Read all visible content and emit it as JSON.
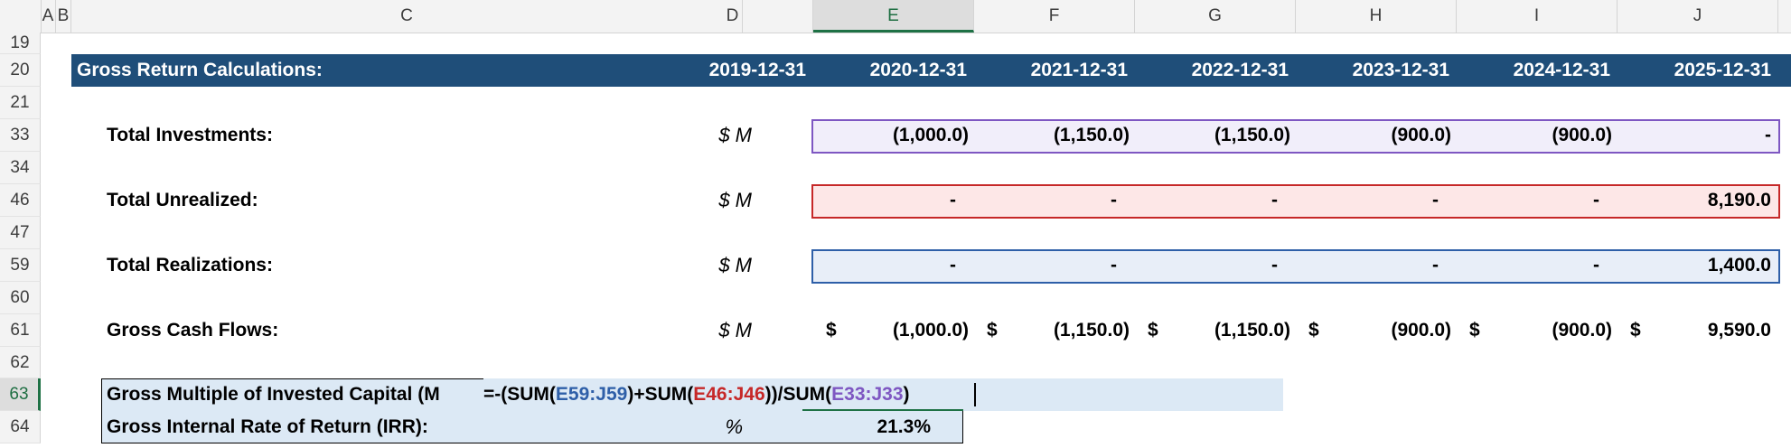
{
  "columns": [
    "A",
    "B",
    "C",
    "D",
    "E",
    "F",
    "G",
    "H",
    "I",
    "J"
  ],
  "rows": [
    "19",
    "20",
    "21",
    "33",
    "34",
    "46",
    "47",
    "59",
    "60",
    "61",
    "62",
    "63",
    "64"
  ],
  "selected_column": "E",
  "selected_row": "63",
  "banner": {
    "title": "Gross Return Calculations:",
    "dates": [
      "2019-12-31",
      "2020-12-31",
      "2021-12-31",
      "2022-12-31",
      "2023-12-31",
      "2024-12-31",
      "2025-12-31"
    ]
  },
  "lines": [
    {
      "label": "Total Investments:",
      "unit": "$ M",
      "values": [
        "(1,000.0)",
        "(1,150.0)",
        "(1,150.0)",
        "(900.0)",
        "(900.0)",
        "-"
      ]
    },
    {
      "label": "Total Unrealized:",
      "unit": "$ M",
      "values": [
        "-",
        "-",
        "-",
        "-",
        "-",
        "8,190.0"
      ]
    },
    {
      "label": "Total Realizations:",
      "unit": "$ M",
      "values": [
        "-",
        "-",
        "-",
        "-",
        "-",
        "1,400.0"
      ]
    },
    {
      "label": "Gross Cash Flows:",
      "unit": "$ M",
      "currency_symbol": "$",
      "values": [
        "(1,000.0)",
        "(1,150.0)",
        "(1,150.0)",
        "(900.0)",
        "(900.0)",
        "9,590.0"
      ]
    }
  ],
  "summary": {
    "moic_label": "Gross Multiple of Invested Capital (M",
    "formula": {
      "p1": "=-(SUM(",
      "r1": "E59:J59",
      "p2": ")+SUM(",
      "r2": "E46:J46",
      "p3": "))/SUM(",
      "r3": "E33:J33",
      "p4": ")"
    },
    "irr_label": "Gross Internal Rate of Return (IRR):",
    "irr_unit": "%",
    "irr_value": "21.3%"
  },
  "colors": {
    "banner": "#1f4e79",
    "investments_range": "#7e57c2",
    "investments_fill": "#f1eefa",
    "unrealized_range": "#c62828",
    "unrealized_fill": "#fde7e7",
    "realizations_range": "#2e5fa8",
    "realizations_fill": "#e8eef8",
    "summary_fill": "#dce9f5"
  }
}
